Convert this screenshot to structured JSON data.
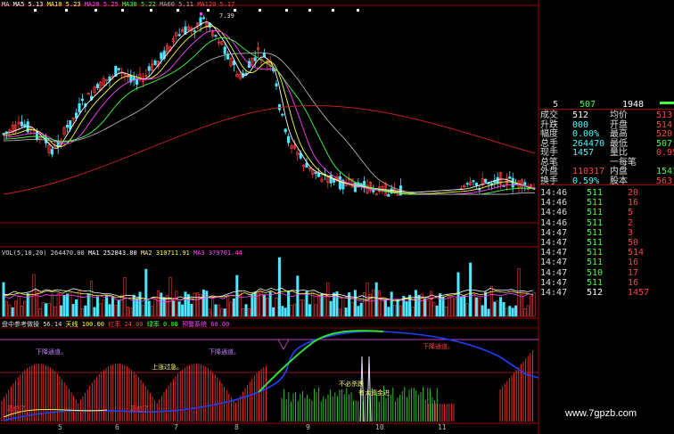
{
  "main_legend": {
    "ma": "MA",
    "ma5": "MA5 5.13",
    "ma10": "MA10 5.23",
    "ma20": "MA20 5.25",
    "ma30": "MA30 5.22",
    "ma60": "MA60 5.11",
    "ma120": "MA120 5.17"
  },
  "price_high_label": "7.39",
  "volume_legend": {
    "vol": "VOL(5,10,20)",
    "value": "264470.00",
    "ma1": "MA1 252843.80",
    "ma2": "MA2 310711.91",
    "ma3": "MA3 379701.44"
  },
  "indicator_legend": {
    "name": "盘中参考做操 56.14",
    "l1": "天线 100.00",
    "l2": "红率 24.00",
    "l3": "绿率 0.00",
    "l4": "预警系统 60.00"
  },
  "indicator_annotations": {
    "down_channel_1": "下降通道。",
    "down_channel_2": "下降通道。",
    "up_channel": "上涨过急。",
    "down_channel_3": "下降通道。",
    "no_chase": "不必杀跌",
    "fund_inflow": "有大资金进",
    "left_1": "高位了",
    "left_2": "高位了"
  },
  "x_axis_ticks": [
    "5",
    "6",
    "7",
    "8",
    "9",
    "10",
    "11"
  ],
  "quote_panel": {
    "top_left": "5",
    "top_mid": "507",
    "top_right": "1948",
    "rows": [
      {
        "l1": "成交",
        "v1": "512",
        "l2": "均价",
        "v2": "513"
      },
      {
        "l1": "升跌",
        "v1": "000",
        "l2": "开盘",
        "v2": "514"
      },
      {
        "l1": "幅度",
        "v1": "0.00%",
        "l2": "最高",
        "v2": "520"
      },
      {
        "l1": "总手",
        "v1": "264470",
        "l2": "最低",
        "v2": "507"
      },
      {
        "l1": "现手",
        "v1": "1457",
        "l2": "量比",
        "v2": "0.95"
      },
      {
        "l1": "总笔",
        "v1": "",
        "l2": "一每笔",
        "v2": ""
      },
      {
        "l1": "外盘",
        "v1": "110317",
        "l2": "内盘",
        "v2": "154153"
      },
      {
        "l1": "换手",
        "v1": "0.59%",
        "l2": "股本",
        "v2": "563"
      }
    ],
    "ticks": [
      {
        "time": "14:46",
        "price": "511",
        "vol": "20"
      },
      {
        "time": "14:46",
        "price": "511",
        "vol": "16"
      },
      {
        "time": "14:46",
        "price": "511",
        "vol": "5"
      },
      {
        "time": "14:46",
        "price": "511",
        "vol": "2"
      },
      {
        "time": "14:47",
        "price": "511",
        "vol": "3"
      },
      {
        "time": "14:47",
        "price": "511",
        "vol": "50"
      },
      {
        "time": "14:47",
        "price": "511",
        "vol": "514"
      },
      {
        "time": "14:47",
        "price": "511",
        "vol": "16"
      },
      {
        "time": "14:47",
        "price": "510",
        "vol": "17"
      },
      {
        "time": "14:47",
        "price": "511",
        "vol": "16"
      },
      {
        "time": "14:47",
        "price": "512",
        "vol": "1457"
      }
    ]
  },
  "watermark": "www.7gpzb.com",
  "colors": {
    "up": "#ff3b3b",
    "down": "#4fe6ff",
    "ma5": "#ffffff",
    "ma10": "#ffff40",
    "ma20": "#ff40ff",
    "ma30": "#40ff40",
    "ma60": "#b0b0b0",
    "ma120": "#c02020",
    "grid": "#8a0000"
  }
}
